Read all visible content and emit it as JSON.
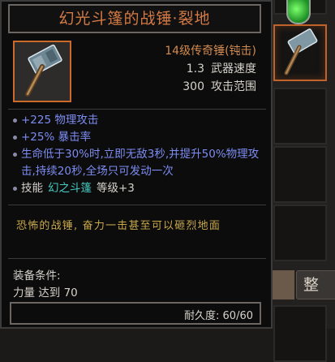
{
  "item": {
    "title": "幻光斗篷的战锤·裂地",
    "type_line": "14级传奇锤(钝击)",
    "speed_value": "1.3",
    "speed_label": "武器速度",
    "range_value": "300",
    "range_label": "攻击范围",
    "icon": "warhammer-icon"
  },
  "affixes": [
    "+225 物理攻击",
    "+25% 暴击率",
    "生命低于30%时,立即无敌3秒,并提升50%物理攻击,持续20秒,全场只可发动一次"
  ],
  "skill": {
    "prefix": "技能",
    "name": "幻之斗篷",
    "level": "等级+3"
  },
  "flavor": "恐怖的战锤, 奋力一击甚至可以砸烈地面",
  "requirements": {
    "label": "装备条件:",
    "line": "力量 达到 70"
  },
  "durability": "耐久度: 60/60",
  "inventory": {
    "sort_button": "整"
  },
  "colors": {
    "title": "#d47a44",
    "legendary": "#d28a4e",
    "affix": "#7d8cf2",
    "skill_name": "#46c9c0",
    "flavor": "#c9a94a",
    "selected_border": "#cc6a2c"
  }
}
